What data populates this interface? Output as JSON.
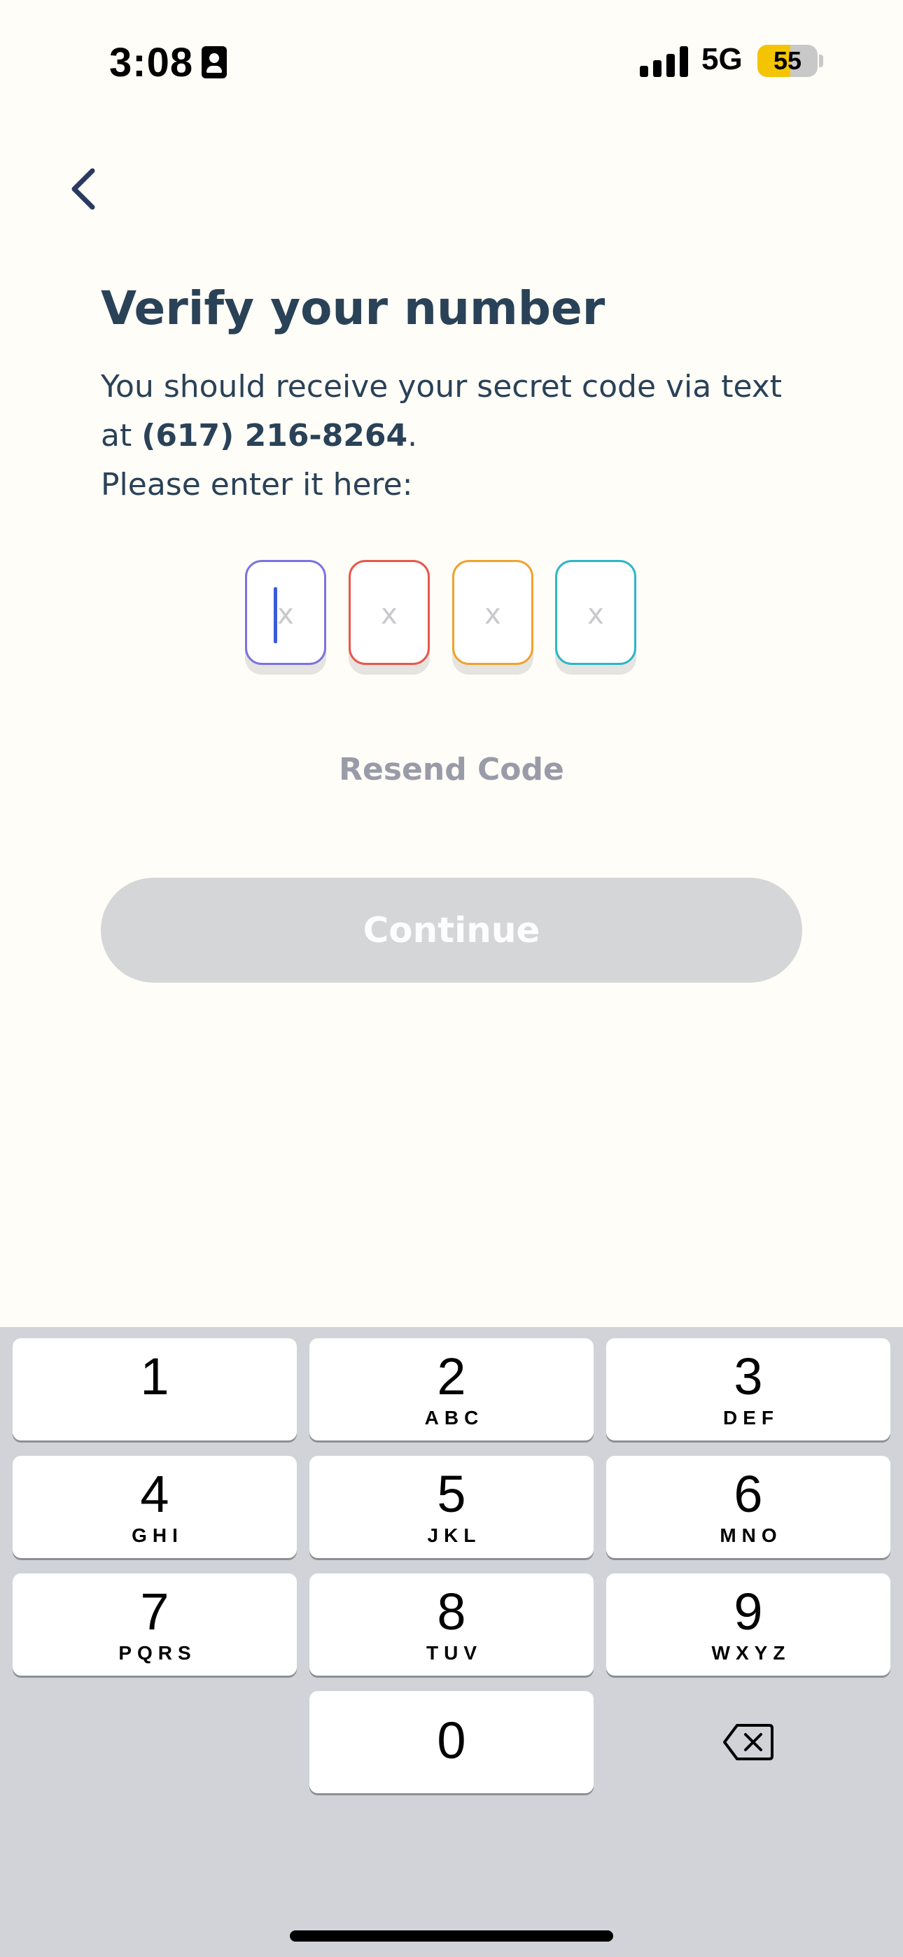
{
  "status_bar": {
    "time": "3:08",
    "network": "5G",
    "battery": "55",
    "battery_level": 0.55,
    "icons": [
      "contact-card-icon",
      "cellular-signal-icon",
      "battery-icon"
    ]
  },
  "header": {
    "back_icon": "chevron-left-icon"
  },
  "verify": {
    "title": "Verify your number",
    "line1": "You should receive your secret code via text",
    "at_prefix": "at ",
    "phone": "(617) 216-8264",
    "period": ".",
    "line3": "Please enter it here:"
  },
  "code_inputs": [
    {
      "placeholder": "x",
      "color": "#7b73e0",
      "focused": true
    },
    {
      "placeholder": "x",
      "color": "#e8574a",
      "focused": false
    },
    {
      "placeholder": "x",
      "color": "#f0a22c",
      "focused": false
    },
    {
      "placeholder": "x",
      "color": "#2bb7c7",
      "focused": false
    }
  ],
  "resend_label": "Resend Code",
  "continue_label": "Continue",
  "colors": {
    "background": "#fffdf8",
    "text": "#2a4257",
    "disabled_button": "#d5d6d8",
    "keyboard": "#d1d3d8"
  },
  "keypad": {
    "keys": [
      {
        "digit": "1",
        "letters": ""
      },
      {
        "digit": "2",
        "letters": "ABC"
      },
      {
        "digit": "3",
        "letters": "DEF"
      },
      {
        "digit": "4",
        "letters": "GHI"
      },
      {
        "digit": "5",
        "letters": "JKL"
      },
      {
        "digit": "6",
        "letters": "MNO"
      },
      {
        "digit": "7",
        "letters": "PQRS"
      },
      {
        "digit": "8",
        "letters": "TUV"
      },
      {
        "digit": "9",
        "letters": "WXYZ"
      },
      {
        "digit": "0",
        "letters": ""
      }
    ],
    "delete_icon": "backspace-icon"
  }
}
